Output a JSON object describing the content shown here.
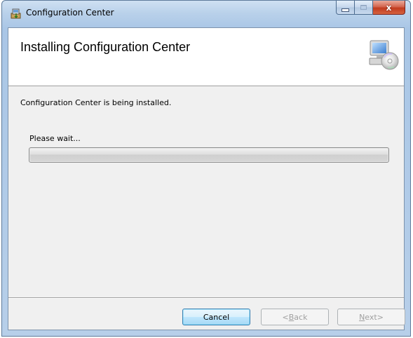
{
  "window": {
    "title": "Configuration Center",
    "caption_buttons": {
      "minimize": "–",
      "maximize": "□",
      "close": "x"
    }
  },
  "banner": {
    "title": "Installing Configuration Center",
    "icon": "computer-cd-icon"
  },
  "body": {
    "status": "Configuration Center is being installed.",
    "wait": "Please wait...",
    "progress_value": 0.0
  },
  "footer": {
    "cancel": "Cancel",
    "back_prefix": "< ",
    "back_accel": "B",
    "back_rest": "ack",
    "next_accel": "N",
    "next_rest": "ext",
    "next_suffix": " >"
  },
  "colors": {
    "titlebar": "#b9d1ea",
    "client_bg": "#f0f0f0",
    "close_red": "#c13b1f",
    "default_button_border": "#3c7fb1"
  }
}
